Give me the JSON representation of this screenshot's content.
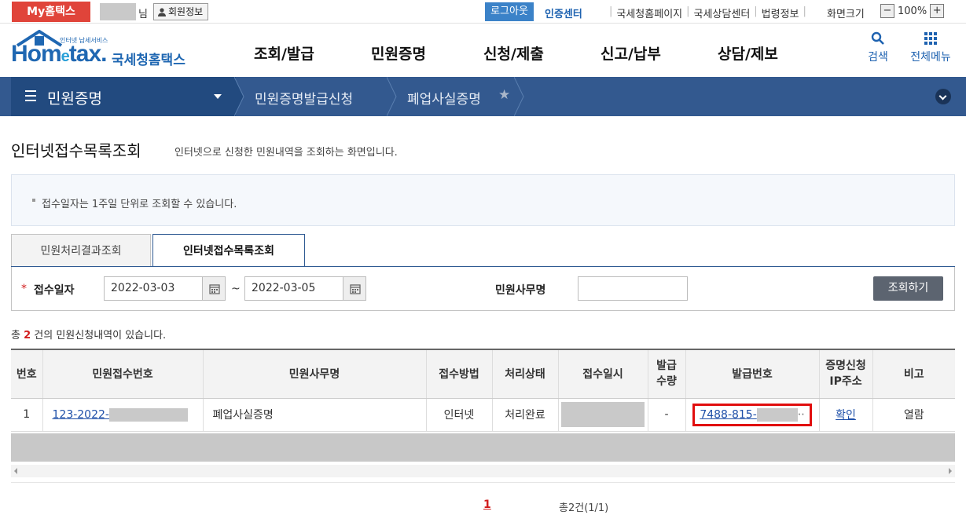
{
  "topbar": {
    "my_hometax": "My홈택스",
    "user_suffix": "님",
    "member_info": "회원정보",
    "logout": "로그아웃",
    "cert_center": "인증센터",
    "links": [
      "국세청홈페이지",
      "국세상담센터",
      "법령정보"
    ],
    "zoom_label": "화면크기",
    "zoom_minus": "−",
    "zoom_value": "100%",
    "zoom_plus": "+"
  },
  "header": {
    "logo_small": "인터넷 납세서비스",
    "logo_home": "Hom",
    "logo_e": "e",
    "logo_tax": "tax.",
    "logo_korean": "국세청홈택스",
    "gnb": [
      "조회/발급",
      "민원증명",
      "신청/제출",
      "신고/납부",
      "상담/제보"
    ],
    "search_label": "검색",
    "allmenu_label": "전체메뉴"
  },
  "location": {
    "section": "민원증명",
    "items": [
      "민원증명발급신청",
      "폐업사실증명"
    ]
  },
  "page": {
    "title": "인터넷접수목록조회",
    "description": "인터넷으로 신청한 민원내역을 조회하는 화면입니다.",
    "info": "접수일자는 1주일 단위로 조회할 수 있습니다."
  },
  "tabs": [
    "민원처리결과조회",
    "인터넷접수목록조회"
  ],
  "search": {
    "required_mark": "*",
    "date_label": "접수일자",
    "from_date": "2022-03-03",
    "tilde": "~",
    "to_date": "2022-03-05",
    "office_label": "민원사무명",
    "office_value": "",
    "submit": "조회하기"
  },
  "count": {
    "prefix": "총",
    "value": "2",
    "suffix": "건의 민원신청내역이 있습니다."
  },
  "table": {
    "headers": [
      "번호",
      "민원접수번호",
      "민원사무명",
      "접수방법",
      "처리상태",
      "접수일시",
      "발급\n수량",
      "발급번호",
      "증명신청\nIP주소",
      "비고"
    ],
    "rows": [
      {
        "no": "1",
        "receipt_no": "123-2022-",
        "office": "폐업사실증명",
        "method": "인터넷",
        "status": "처리완료",
        "qty": "-",
        "issue_no": "7488-815-",
        "ip": "확인",
        "note": "열람"
      }
    ]
  },
  "pagination": {
    "current": "1",
    "total_text": "총2건(1/1)"
  },
  "colors": {
    "brand_blue": "#1f67b2",
    "nav_bar": "#33598f",
    "highlight": "#e10e0e",
    "my_hometax": "#e0443a"
  }
}
